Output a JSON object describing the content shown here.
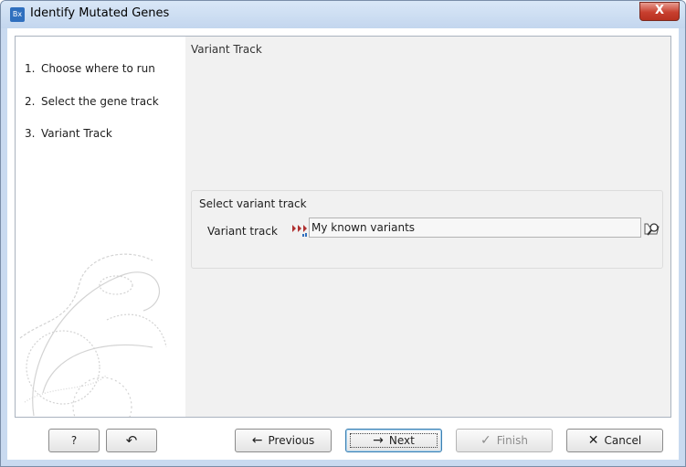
{
  "window": {
    "title": "Identify Mutated Genes",
    "app_icon": "Bx",
    "close_label": "X"
  },
  "steps": [
    {
      "num": "1.",
      "label": "Choose where to run"
    },
    {
      "num": "2.",
      "label": "Select the gene track"
    },
    {
      "num": "3.",
      "label": "Variant Track"
    }
  ],
  "content": {
    "title": "Variant Track",
    "group_title": "Select variant track",
    "field_label": "Variant track",
    "field_value": "My known variants"
  },
  "buttons": {
    "help": "?",
    "reset": "↶",
    "previous": "Previous",
    "next": "Next",
    "finish": "Finish",
    "cancel": "Cancel"
  },
  "icons": {
    "previous": "←",
    "next": "→",
    "finish": "✓",
    "cancel": "✕"
  },
  "colors": {
    "accent": "#2f6fbe",
    "close": "#c8402f"
  }
}
